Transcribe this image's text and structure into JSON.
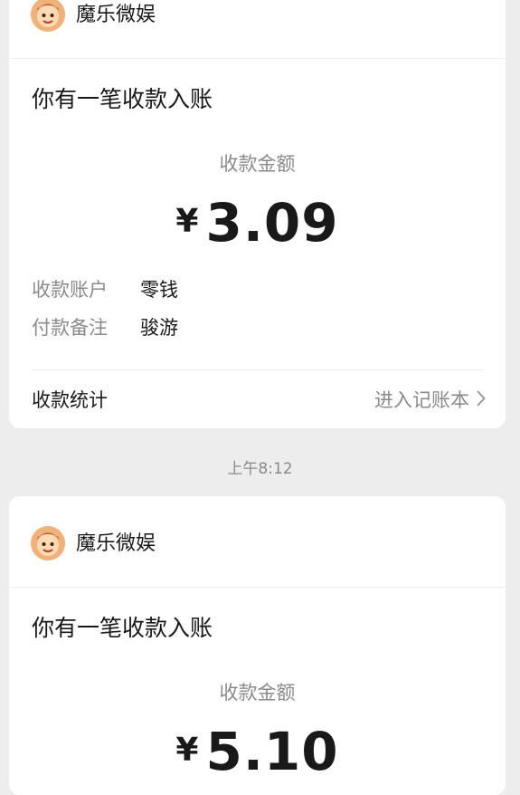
{
  "messages": [
    {
      "merchant": "魔乐微娱",
      "title": "你有一笔收款入账",
      "amount_label": "收款金额",
      "currency": "¥",
      "amount": "3.09",
      "details": [
        {
          "key": "收款账户",
          "value": "零钱"
        },
        {
          "key": "付款备注",
          "value": "骏游"
        }
      ],
      "footer": {
        "left": "收款统计",
        "right": "进入记账本"
      }
    },
    {
      "merchant": "魔乐微娱",
      "title": "你有一笔收款入账",
      "amount_label": "收款金额",
      "currency": "¥",
      "amount": "5.10"
    }
  ],
  "timestamp": "上午8:12",
  "colors": {
    "background": "#ededed",
    "card": "#ffffff",
    "primary_text": "#191919",
    "secondary_text": "#8a8a8a",
    "avatar": "#e3a36c"
  },
  "icons": [
    "merchant-avatar-icon",
    "chevron-right-icon"
  ]
}
